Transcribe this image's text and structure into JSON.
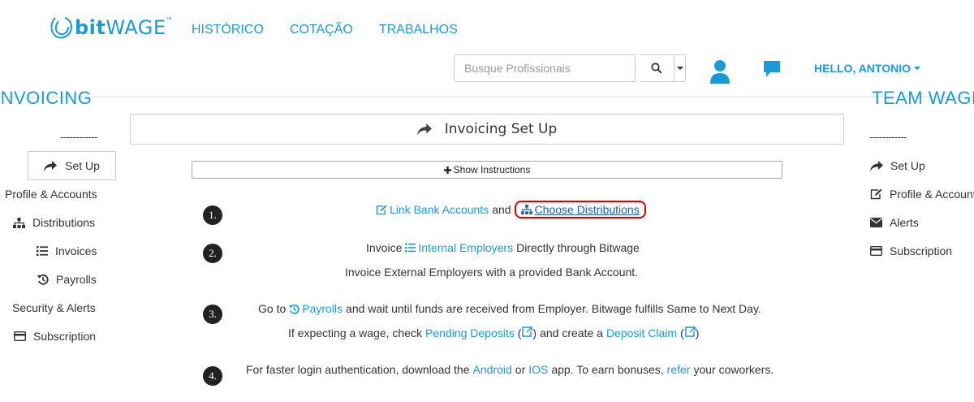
{
  "brand": {
    "name_bold": "bit",
    "name_rest": "WAGE",
    "tm": "™"
  },
  "topnav": [
    "HISTÓRICO",
    "COTAÇÃO",
    "TRABALHOS"
  ],
  "search": {
    "placeholder": "Busque Profissionais"
  },
  "user": {
    "greeting": "HELLO, ANTONIO"
  },
  "left_sidebar": {
    "title": "INVOICING",
    "divider": "------------",
    "items": [
      "Set Up",
      "Profile & Accounts",
      "Distributions",
      "Invoices",
      "Payrolls",
      "Security & Alerts",
      "Subscription"
    ]
  },
  "right_sidebar": {
    "title": "TEAM WAGE",
    "divider": "------------",
    "items": [
      "Set Up",
      "Profile & Accounts",
      "Alerts",
      "Subscription"
    ]
  },
  "main": {
    "header": "Invoicing Set Up",
    "instructions_button": "Show Instructions",
    "steps": [
      {
        "num": "1.",
        "link_bank": "Link Bank Accounts",
        "and": "and",
        "choose_dist": "Choose Distributions"
      },
      {
        "num": "2.",
        "line1_pre": "Invoice",
        "line1_link": "Internal Employers",
        "line1_post": "Directly through Bitwage",
        "line2": "Invoice External Employers with a provided Bank Account."
      },
      {
        "num": "3.",
        "line1_pre": "Go to",
        "line1_link": "Payrolls",
        "line1_post": "and wait until funds are received from Employer. Bitwage fulfills Same to Next Day.",
        "line2_pre": "If expecting a wage, check",
        "line2_link1": "Pending Deposits",
        "line2_mid": "and create a",
        "line2_link2": "Deposit Claim"
      },
      {
        "num": "4.",
        "pre": "For faster login authentication, download the",
        "android": "Android",
        "or": "or",
        "ios": "IOS",
        "mid": "app. To earn bonuses,",
        "refer": "refer",
        "post": "your coworkers."
      }
    ]
  },
  "colors": {
    "accent": "#1a9bd7",
    "highlight": "#e00000"
  }
}
